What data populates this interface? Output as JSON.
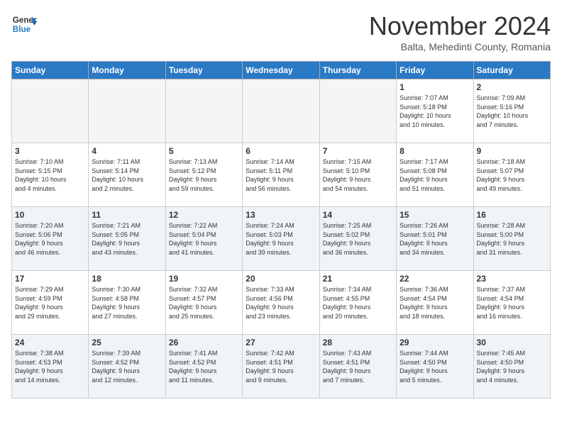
{
  "logo": {
    "line1": "General",
    "line2": "Blue"
  },
  "title": "November 2024",
  "location": "Balta, Mehedinti County, Romania",
  "weekdays": [
    "Sunday",
    "Monday",
    "Tuesday",
    "Wednesday",
    "Thursday",
    "Friday",
    "Saturday"
  ],
  "weeks": [
    [
      {
        "day": "",
        "info": "",
        "empty": true
      },
      {
        "day": "",
        "info": "",
        "empty": true
      },
      {
        "day": "",
        "info": "",
        "empty": true
      },
      {
        "day": "",
        "info": "",
        "empty": true
      },
      {
        "day": "",
        "info": "",
        "empty": true
      },
      {
        "day": "1",
        "info": "Sunrise: 7:07 AM\nSunset: 5:18 PM\nDaylight: 10 hours\nand 10 minutes."
      },
      {
        "day": "2",
        "info": "Sunrise: 7:09 AM\nSunset: 5:16 PM\nDaylight: 10 hours\nand 7 minutes."
      }
    ],
    [
      {
        "day": "3",
        "info": "Sunrise: 7:10 AM\nSunset: 5:15 PM\nDaylight: 10 hours\nand 4 minutes."
      },
      {
        "day": "4",
        "info": "Sunrise: 7:11 AM\nSunset: 5:14 PM\nDaylight: 10 hours\nand 2 minutes."
      },
      {
        "day": "5",
        "info": "Sunrise: 7:13 AM\nSunset: 5:12 PM\nDaylight: 9 hours\nand 59 minutes."
      },
      {
        "day": "6",
        "info": "Sunrise: 7:14 AM\nSunset: 5:11 PM\nDaylight: 9 hours\nand 56 minutes."
      },
      {
        "day": "7",
        "info": "Sunrise: 7:15 AM\nSunset: 5:10 PM\nDaylight: 9 hours\nand 54 minutes."
      },
      {
        "day": "8",
        "info": "Sunrise: 7:17 AM\nSunset: 5:08 PM\nDaylight: 9 hours\nand 51 minutes."
      },
      {
        "day": "9",
        "info": "Sunrise: 7:18 AM\nSunset: 5:07 PM\nDaylight: 9 hours\nand 49 minutes."
      }
    ],
    [
      {
        "day": "10",
        "info": "Sunrise: 7:20 AM\nSunset: 5:06 PM\nDaylight: 9 hours\nand 46 minutes.",
        "shaded": true
      },
      {
        "day": "11",
        "info": "Sunrise: 7:21 AM\nSunset: 5:05 PM\nDaylight: 9 hours\nand 43 minutes.",
        "shaded": true
      },
      {
        "day": "12",
        "info": "Sunrise: 7:22 AM\nSunset: 5:04 PM\nDaylight: 9 hours\nand 41 minutes.",
        "shaded": true
      },
      {
        "day": "13",
        "info": "Sunrise: 7:24 AM\nSunset: 5:03 PM\nDaylight: 9 hours\nand 39 minutes.",
        "shaded": true
      },
      {
        "day": "14",
        "info": "Sunrise: 7:25 AM\nSunset: 5:02 PM\nDaylight: 9 hours\nand 36 minutes.",
        "shaded": true
      },
      {
        "day": "15",
        "info": "Sunrise: 7:26 AM\nSunset: 5:01 PM\nDaylight: 9 hours\nand 34 minutes.",
        "shaded": true
      },
      {
        "day": "16",
        "info": "Sunrise: 7:28 AM\nSunset: 5:00 PM\nDaylight: 9 hours\nand 31 minutes.",
        "shaded": true
      }
    ],
    [
      {
        "day": "17",
        "info": "Sunrise: 7:29 AM\nSunset: 4:59 PM\nDaylight: 9 hours\nand 29 minutes."
      },
      {
        "day": "18",
        "info": "Sunrise: 7:30 AM\nSunset: 4:58 PM\nDaylight: 9 hours\nand 27 minutes."
      },
      {
        "day": "19",
        "info": "Sunrise: 7:32 AM\nSunset: 4:57 PM\nDaylight: 9 hours\nand 25 minutes."
      },
      {
        "day": "20",
        "info": "Sunrise: 7:33 AM\nSunset: 4:56 PM\nDaylight: 9 hours\nand 23 minutes."
      },
      {
        "day": "21",
        "info": "Sunrise: 7:34 AM\nSunset: 4:55 PM\nDaylight: 9 hours\nand 20 minutes."
      },
      {
        "day": "22",
        "info": "Sunrise: 7:36 AM\nSunset: 4:54 PM\nDaylight: 9 hours\nand 18 minutes."
      },
      {
        "day": "23",
        "info": "Sunrise: 7:37 AM\nSunset: 4:54 PM\nDaylight: 9 hours\nand 16 minutes."
      }
    ],
    [
      {
        "day": "24",
        "info": "Sunrise: 7:38 AM\nSunset: 4:53 PM\nDaylight: 9 hours\nand 14 minutes.",
        "shaded": true
      },
      {
        "day": "25",
        "info": "Sunrise: 7:39 AM\nSunset: 4:52 PM\nDaylight: 9 hours\nand 12 minutes.",
        "shaded": true
      },
      {
        "day": "26",
        "info": "Sunrise: 7:41 AM\nSunset: 4:52 PM\nDaylight: 9 hours\nand 11 minutes.",
        "shaded": true
      },
      {
        "day": "27",
        "info": "Sunrise: 7:42 AM\nSunset: 4:51 PM\nDaylight: 9 hours\nand 9 minutes.",
        "shaded": true
      },
      {
        "day": "28",
        "info": "Sunrise: 7:43 AM\nSunset: 4:51 PM\nDaylight: 9 hours\nand 7 minutes.",
        "shaded": true
      },
      {
        "day": "29",
        "info": "Sunrise: 7:44 AM\nSunset: 4:50 PM\nDaylight: 9 hours\nand 5 minutes.",
        "shaded": true
      },
      {
        "day": "30",
        "info": "Sunrise: 7:45 AM\nSunset: 4:50 PM\nDaylight: 9 hours\nand 4 minutes.",
        "shaded": true
      }
    ]
  ]
}
